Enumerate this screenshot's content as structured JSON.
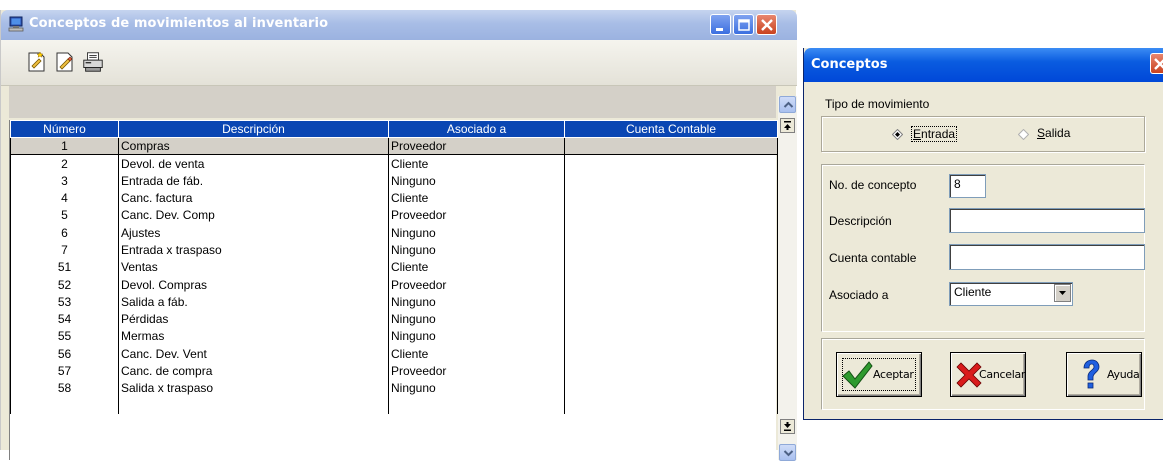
{
  "main_window": {
    "title": "Conceptos de movimientos al inventario",
    "columns": [
      "Número",
      "Descripción",
      "Asociado a",
      "Cuenta Contable"
    ],
    "rows": [
      {
        "numero": "1",
        "descripcion": "Compras",
        "asociado": "Proveedor",
        "cuenta": ""
      },
      {
        "numero": "2",
        "descripcion": "Devol. de venta",
        "asociado": "Cliente",
        "cuenta": ""
      },
      {
        "numero": "3",
        "descripcion": "Entrada de fáb.",
        "asociado": "Ninguno",
        "cuenta": ""
      },
      {
        "numero": "4",
        "descripcion": "Canc. factura",
        "asociado": "Cliente",
        "cuenta": ""
      },
      {
        "numero": "5",
        "descripcion": "Canc. Dev. Comp",
        "asociado": "Proveedor",
        "cuenta": ""
      },
      {
        "numero": "6",
        "descripcion": "Ajustes",
        "asociado": "Ninguno",
        "cuenta": ""
      },
      {
        "numero": "7",
        "descripcion": "Entrada x traspaso",
        "asociado": "Ninguno",
        "cuenta": ""
      },
      {
        "numero": "51",
        "descripcion": "Ventas",
        "asociado": "Cliente",
        "cuenta": ""
      },
      {
        "numero": "52",
        "descripcion": "Devol. Compras",
        "asociado": "Proveedor",
        "cuenta": ""
      },
      {
        "numero": "53",
        "descripcion": "Salida a fáb.",
        "asociado": "Ninguno",
        "cuenta": ""
      },
      {
        "numero": "54",
        "descripcion": "Pérdidas",
        "asociado": "Ninguno",
        "cuenta": ""
      },
      {
        "numero": "55",
        "descripcion": "Mermas",
        "asociado": "Ninguno",
        "cuenta": ""
      },
      {
        "numero": "56",
        "descripcion": "Canc. Dev. Vent",
        "asociado": "Cliente",
        "cuenta": ""
      },
      {
        "numero": "57",
        "descripcion": "Canc. de compra",
        "asociado": "Proveedor",
        "cuenta": ""
      },
      {
        "numero": "58",
        "descripcion": "Salida x traspaso",
        "asociado": "Ninguno",
        "cuenta": ""
      }
    ],
    "selected_row": 0
  },
  "dialog": {
    "title": "Conceptos",
    "tipo_label": "Tipo de movimiento",
    "radio_entrada_pre": "E",
    "radio_entrada_rest": "ntrada",
    "radio_salida_pre": "S",
    "radio_salida_rest": "alida",
    "selected_type": "Entrada",
    "no_concepto_label": "No. de concepto",
    "no_concepto_value": "8",
    "descripcion_label": "Descripción",
    "descripcion_value": "",
    "cuenta_label": "Cuenta contable",
    "cuenta_value": "",
    "asociado_label": "Asociado a",
    "asociado_value": "Cliente",
    "aceptar": "Aceptar",
    "cancelar": "Cancelar",
    "ayuda": "Ayuda"
  },
  "colors": {
    "header_blue": "#0a46b3",
    "title_blue": "#0048d8",
    "window_face": "#ece9d8",
    "selected_row": "#d4d0c8"
  },
  "icons": [
    "computer-icon",
    "new-document-icon",
    "edit-document-icon",
    "printer-icon",
    "minimize-icon",
    "maximize-icon",
    "close-icon",
    "scroll-up-icon",
    "scroll-down-icon",
    "checkmark-icon",
    "red-x-icon",
    "question-icon"
  ]
}
